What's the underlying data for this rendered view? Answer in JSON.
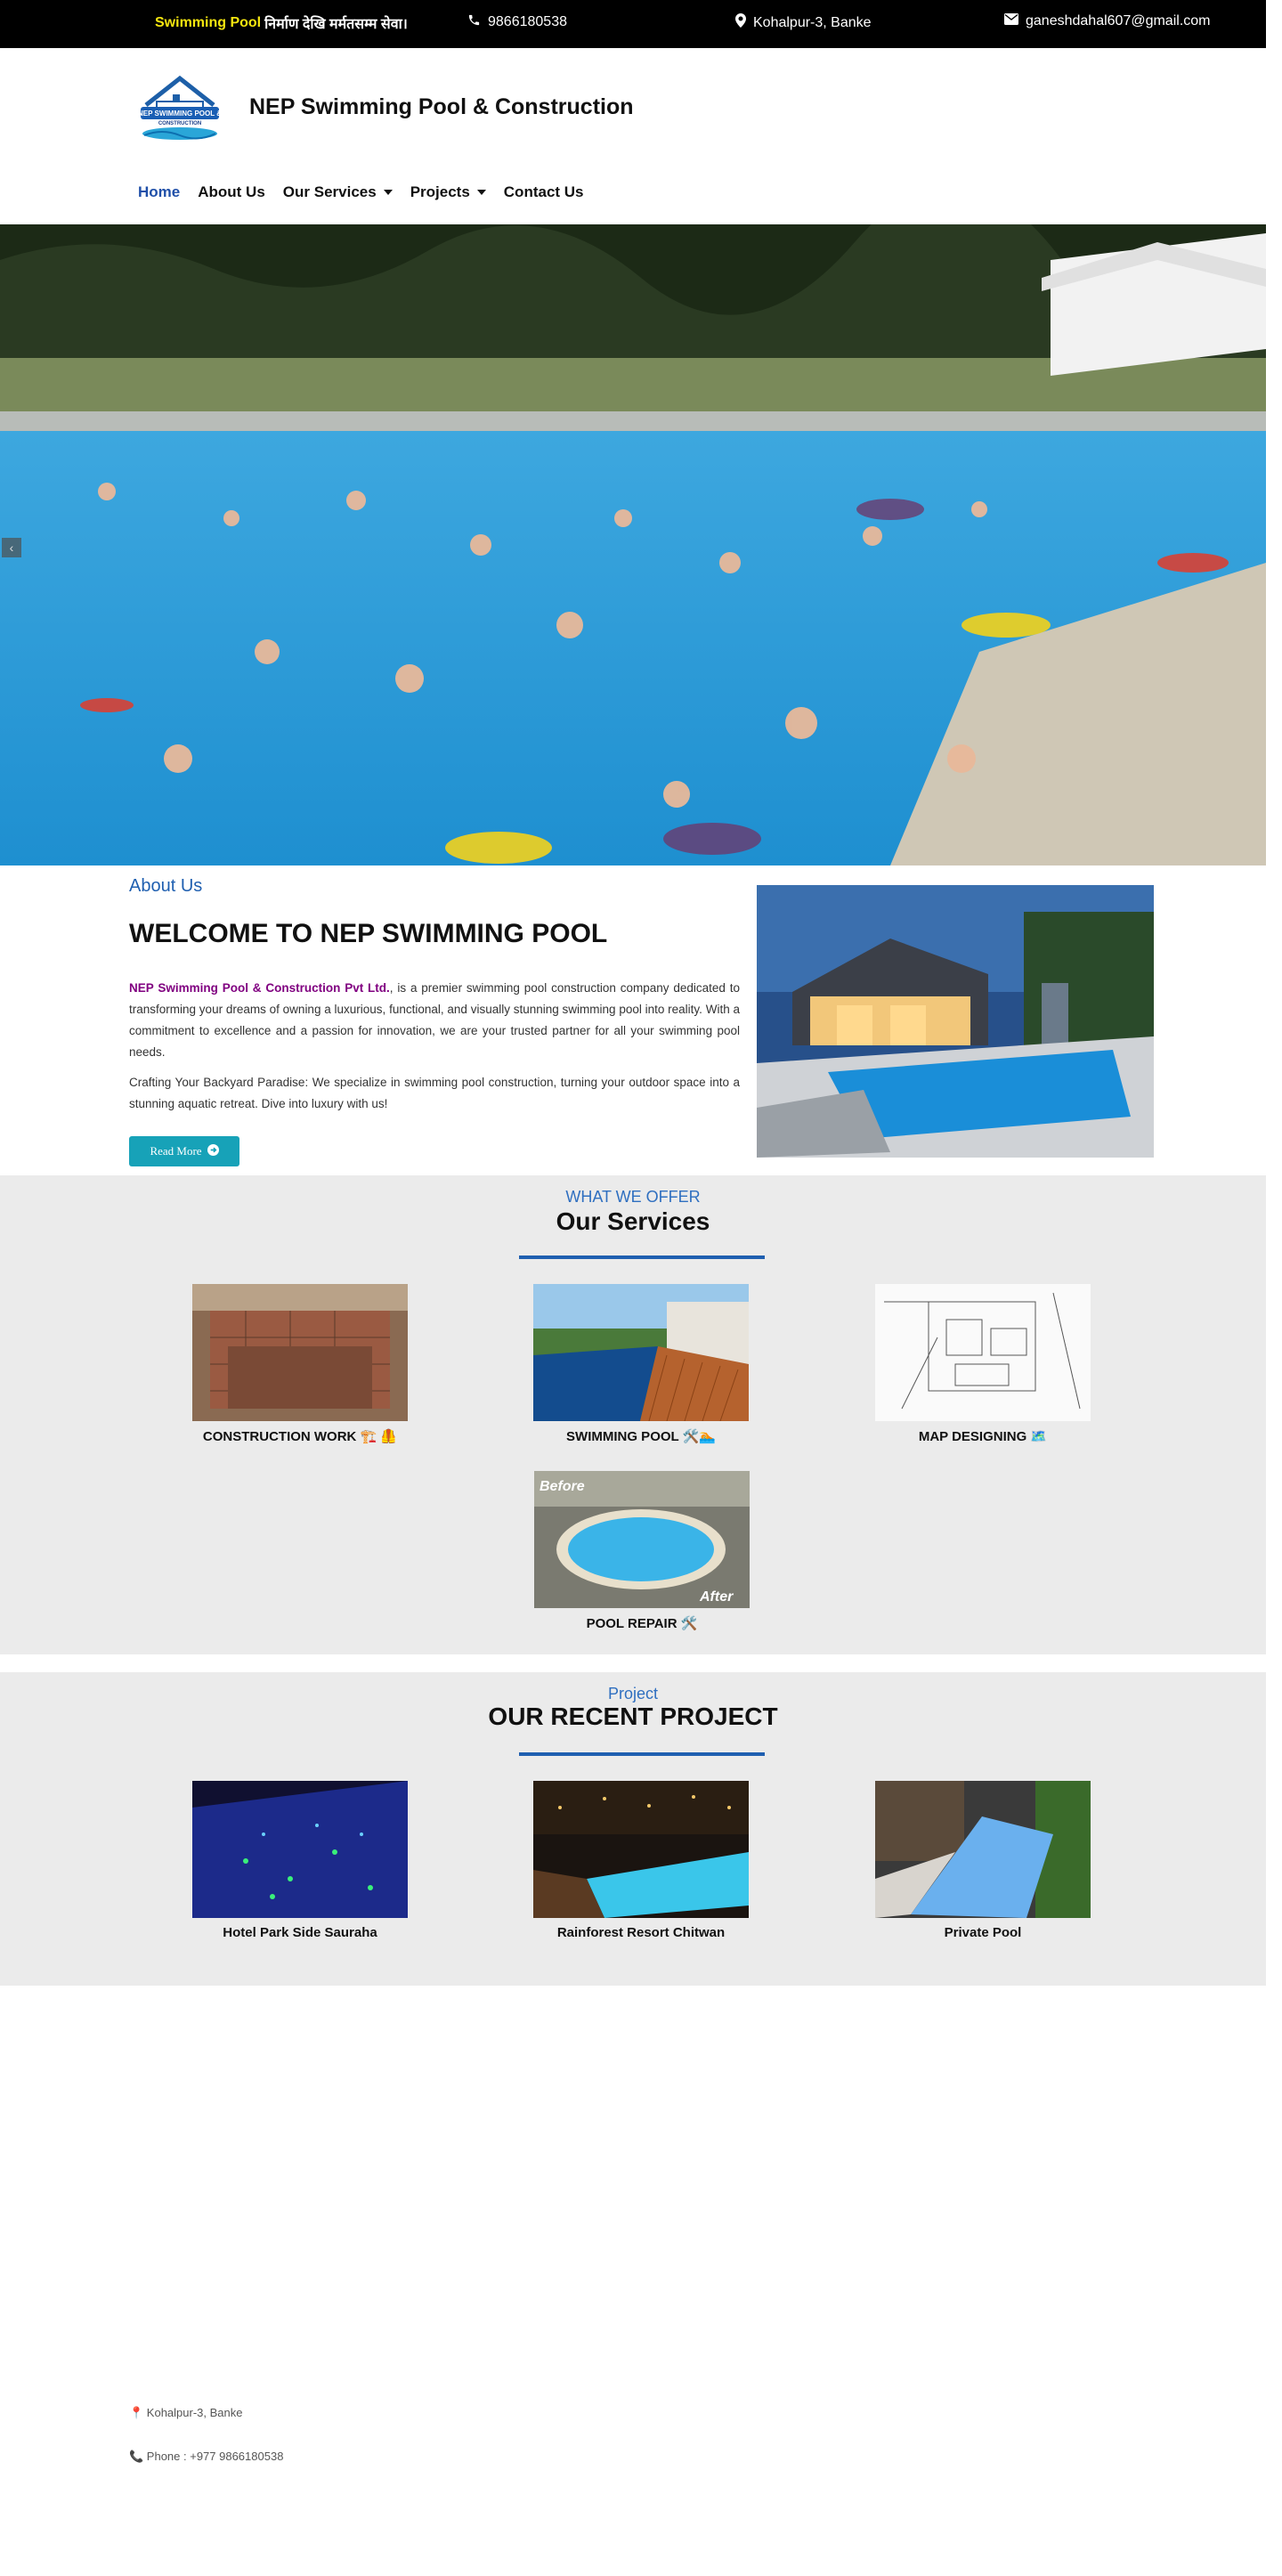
{
  "topbar": {
    "tagline_brand": "Swimming Pool",
    "tagline_rest": "निर्माण देखि मर्मतसम्म सेवा।",
    "phone": "9866180538",
    "location": "Kohalpur-3, Banke",
    "email": "ganeshdahal607@gmail.com"
  },
  "header": {
    "logo_text_1": "NEP SWIMMING POOL &",
    "logo_text_2": "CONSTRUCTION",
    "site_title": "NEP Swimming Pool & Construction"
  },
  "nav": {
    "items": [
      {
        "label": "Home",
        "active": true
      },
      {
        "label": "About Us"
      },
      {
        "label": "Our Services",
        "dropdown": true
      },
      {
        "label": "Projects",
        "dropdown": true
      },
      {
        "label": "Contact Us"
      }
    ]
  },
  "hero": {
    "prev_arrow": "‹"
  },
  "about": {
    "eyebrow": "About Us",
    "title": "WELCOME TO NEP SWIMMING POOL",
    "brand": "NEP Swimming Pool & Construction Pvt Ltd.",
    "p1_rest": ", is a premier swimming pool construction company dedicated to transforming your dreams of owning a luxurious, functional, and visually stunning swimming pool into reality. With a commitment to excellence and a passion for innovation, we are your trusted partner for all your swimming pool needs.",
    "p2": "Crafting Your Backyard Paradise: We specialize in swimming pool construction, turning your outdoor space into a stunning aquatic retreat. Dive into luxury with us!",
    "read_more": "Read More"
  },
  "services": {
    "eyebrow": "WHAT WE OFFER",
    "title": "Our Services",
    "items": [
      {
        "label": "CONSTRUCTION WORK 🏗️ 🦺"
      },
      {
        "label": "SWIMMING POOL 🛠️🏊"
      },
      {
        "label": "MAP DESIGNING 🗺️"
      },
      {
        "label": "POOL REPAIR 🛠️"
      }
    ],
    "before_label": "Before",
    "after_label": "After"
  },
  "projects": {
    "eyebrow": "Project",
    "title": "OUR RECENT PROJECT",
    "items": [
      {
        "label": "Hotel Park Side Sauraha"
      },
      {
        "label": "Rainforest Resort Chitwan"
      },
      {
        "label": "Private Pool"
      }
    ]
  },
  "footer": {
    "address": "📍 Kohalpur-3, Banke",
    "phone": "📞 Phone : +977 9866180538"
  }
}
